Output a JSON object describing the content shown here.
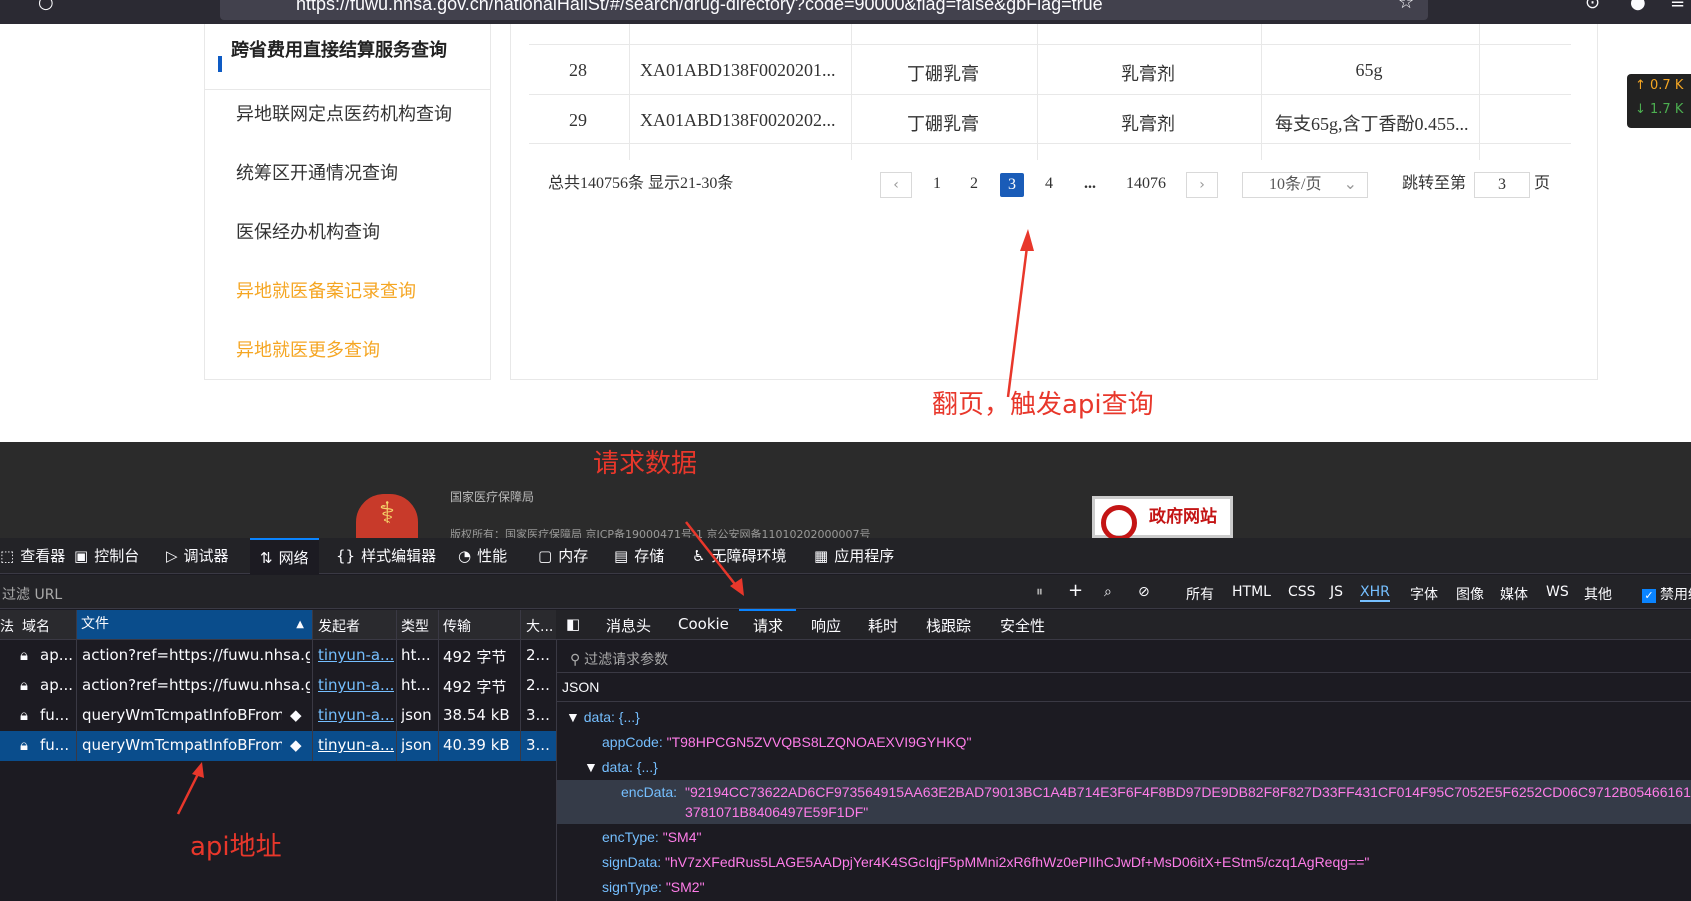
{
  "browser": {
    "url": "https://fuwu.nhsa.gov.cn/nationalHallSt/#/search/drug-directory?code=90000&flag=false&gbFlag=true"
  },
  "sidebar": {
    "title": "跨省费用直接结算服务查询",
    "items": [
      {
        "label": "异地联网定点医药机构查询",
        "highlight": false
      },
      {
        "label": "统筹区开通情况查询",
        "highlight": false
      },
      {
        "label": "医保经办机构查询",
        "highlight": false
      },
      {
        "label": "异地就医备案记录查询",
        "highlight": true
      },
      {
        "label": "异地就医更多查询",
        "highlight": true
      }
    ]
  },
  "table": {
    "rows": [
      {
        "no": "28",
        "code": "XA01ABD138F0020201...",
        "name": "丁硼乳膏",
        "form": "乳膏剂",
        "spec": "65g"
      },
      {
        "no": "29",
        "code": "XA01ABD138F0020202...",
        "name": "丁硼乳膏",
        "form": "乳膏剂",
        "spec": "每支65g,含丁香酚0.455..."
      }
    ]
  },
  "pagination": {
    "summary": "总共140756条  显示21-30条",
    "pages": [
      "1",
      "2",
      "3",
      "4",
      "...",
      "14076"
    ],
    "current": "3",
    "page_size": "10条/页",
    "jump_label": "跳转至第",
    "jump_value": "3",
    "jump_suffix": "页"
  },
  "annotations": {
    "paging": "翻页，触发api查询",
    "request_data": "请求数据",
    "api_address": "api地址"
  },
  "footer": {
    "org": "国家医疗保障局",
    "copyright": "版权所有：国家医疗保障局  京ICP备19000471号-1  京公安网备11010202000007号",
    "gov_badge": "政府网站"
  },
  "side_widget": {
    "up": "↑ 0.7 K",
    "down": "↓ 1.7 K"
  },
  "devtools": {
    "tabs": [
      {
        "icon": "inspector-icon",
        "glyph": "⬚",
        "label": "查看器"
      },
      {
        "icon": "console-icon",
        "glyph": "▣",
        "label": "控制台"
      },
      {
        "icon": "debugger-icon",
        "glyph": "▷",
        "label": "调试器"
      },
      {
        "icon": "network-icon",
        "glyph": "⇅",
        "label": "网络"
      },
      {
        "icon": "style-editor-icon",
        "glyph": "{}",
        "label": "样式编辑器"
      },
      {
        "icon": "performance-icon",
        "glyph": "◔",
        "label": "性能"
      },
      {
        "icon": "memory-icon",
        "glyph": "▢",
        "label": "内存"
      },
      {
        "icon": "storage-icon",
        "glyph": "▤",
        "label": "存储"
      },
      {
        "icon": "accessibility-icon",
        "glyph": "♿",
        "label": "无障碍环境"
      },
      {
        "icon": "application-icon",
        "glyph": "▦",
        "label": "应用程序"
      }
    ],
    "filter_placeholder": "过滤 URL",
    "filter_types": [
      "所有",
      "HTML",
      "CSS",
      "JS",
      "XHR",
      "字体",
      "图像",
      "媒体",
      "WS",
      "其他"
    ],
    "selected_type": "XHR",
    "disable_cache": "禁用缓",
    "columns": [
      "法",
      "域名",
      "文件",
      "发起者",
      "类型",
      "传输",
      "大..."
    ],
    "requests": [
      {
        "domain": "ap...",
        "file": "action?ref=https://fuwu.nhsa.gov.c",
        "initiator": "tinyun-a...",
        "type": "ht...",
        "transfer": "492 字节",
        "size": "2..."
      },
      {
        "domain": "ap...",
        "file": "action?ref=https://fuwu.nhsa.gov.c",
        "initiator": "tinyun-a...",
        "type": "ht...",
        "transfer": "492 字节",
        "size": "2..."
      },
      {
        "domain": "fu...",
        "file": "queryWmTcmpatInfoBFromEs",
        "initiator": "tinyun-a...",
        "type": "json",
        "transfer": "38.54 kB",
        "size": "3..."
      },
      {
        "domain": "fu...",
        "file": "queryWmTcmpatInfoBFromEs",
        "initiator": "tinyun-a...",
        "type": "json",
        "transfer": "40.39 kB",
        "size": "3..."
      }
    ],
    "detail_tabs": [
      "消息头",
      "Cookie",
      "请求",
      "响应",
      "耗时",
      "栈跟踪",
      "安全性"
    ],
    "active_detail_tab": "请求",
    "filter_params": "过滤请求参数",
    "json_label": "JSON",
    "json": {
      "root": "data: {...}",
      "appCode_key": "appCode:",
      "appCode_val": "\"T98HPCGN5ZVVQBS8LZQNOAEXVI9GYHKQ\"",
      "inner": "data: {...}",
      "encData_key": "encData:",
      "encData_val1": "\"92194CC73622AD6CF973564915AA63E2BAD79013BC1A4B714E3F6F4F8BD97DE9DB82F8F827D33FF431CF014F95C7052E5F6252CD06C9712B05466161",
      "encData_val2": "3781071B8406497E59F1DF\"",
      "encType_key": "encType:",
      "encType_val": "\"SM4\"",
      "signData_key": "signData:",
      "signData_val": "\"hV7zXFedRus5LAGE5AADpjYer4K4SGcIqjF5pMMni2xR6fhWz0ePIIhCJwDf+MsD06itX+EStm5/czq1AgReqg==\"",
      "signType_key": "signType:",
      "signType_val": "\"SM2\""
    }
  }
}
